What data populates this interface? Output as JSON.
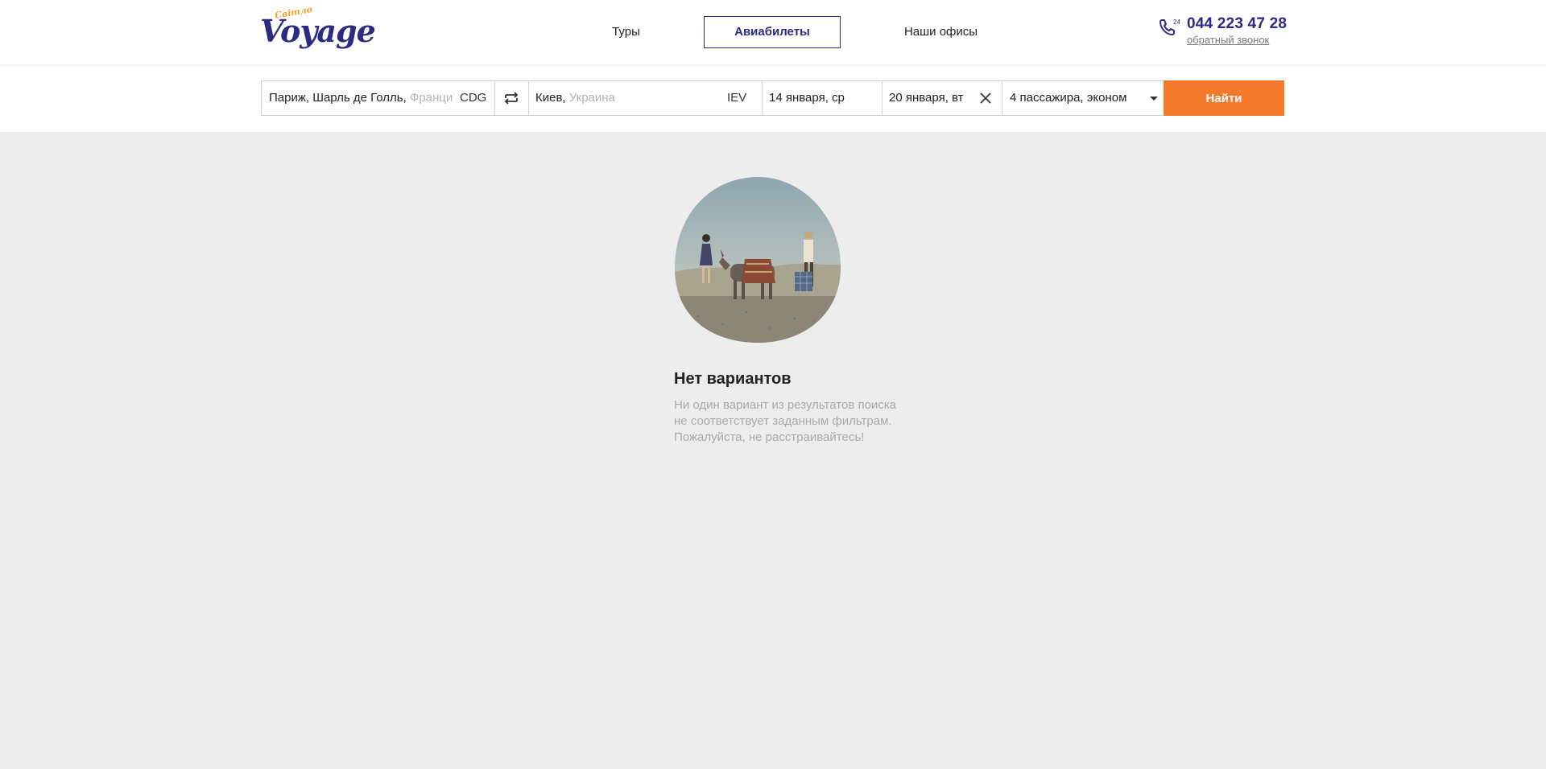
{
  "logo": {
    "small_text": "Світло",
    "main_text": "Voyage"
  },
  "nav": {
    "items": [
      {
        "label": "Туры"
      },
      {
        "label": "Авиабилеты"
      },
      {
        "label": "Наши офисы"
      }
    ]
  },
  "contact": {
    "phone_badge": "24",
    "phone": "044 223 47 28",
    "callback_label": "обратный звонок"
  },
  "search": {
    "from_city": "Париж, Шарль де Голль,",
    "from_country": "Франция",
    "from_code": "CDG",
    "to_city": "Киев,",
    "to_country": "Украина",
    "to_code": "IEV",
    "depart_date": "14 января, ср",
    "return_date": "20 января, вт",
    "passengers": "4 пассажира, эконом",
    "find_label": "Найти"
  },
  "empty_state": {
    "title": "Нет вариантов",
    "lines": [
      "Ни один вариант из результатов поиска",
      "не соответствует заданным фильтрам.",
      "Пожалуйста, не расстраивайтесь!"
    ]
  },
  "colors": {
    "brand": "#2d2a82",
    "accent": "#f5792a",
    "logo_accent": "#f7a12a",
    "page_bg": "#ededed"
  }
}
